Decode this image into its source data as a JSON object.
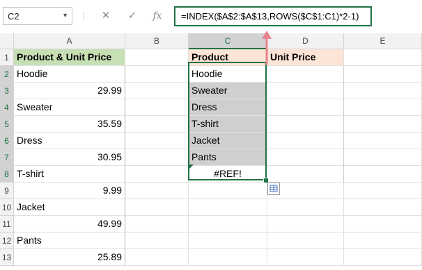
{
  "name_box": {
    "value": "C2"
  },
  "formula_bar": {
    "cancel_icon": "✕",
    "enter_icon": "✓",
    "fx_label": "fx",
    "formula": "=INDEX($A$2:$A$13,ROWS($C$1:C1)*2-1)"
  },
  "columns": [
    "A",
    "B",
    "C",
    "D",
    "E"
  ],
  "rows": [
    "1",
    "2",
    "3",
    "4",
    "5",
    "6",
    "7",
    "8",
    "9",
    "10",
    "11",
    "12",
    "13"
  ],
  "col_a": {
    "header": "Product & Unit Price",
    "values": [
      "Hoodie",
      "29.99",
      "Sweater",
      "35.59",
      "Dress",
      "30.95",
      "T-shirt",
      "9.99",
      "Jacket",
      "49.99",
      "Pants",
      "25.89"
    ]
  },
  "col_c": {
    "header": "Product",
    "values": [
      "Hoodie",
      "Sweater",
      "Dress",
      "T-shirt",
      "Jacket",
      "Pants",
      "#REF!"
    ]
  },
  "col_d": {
    "header": "Unit Price"
  },
  "colors": {
    "accent": "#217346",
    "arrow": "#e8838f",
    "green_header": "#c6e0b4",
    "peach_header": "#fce4d6",
    "selection": "#d0cece"
  }
}
